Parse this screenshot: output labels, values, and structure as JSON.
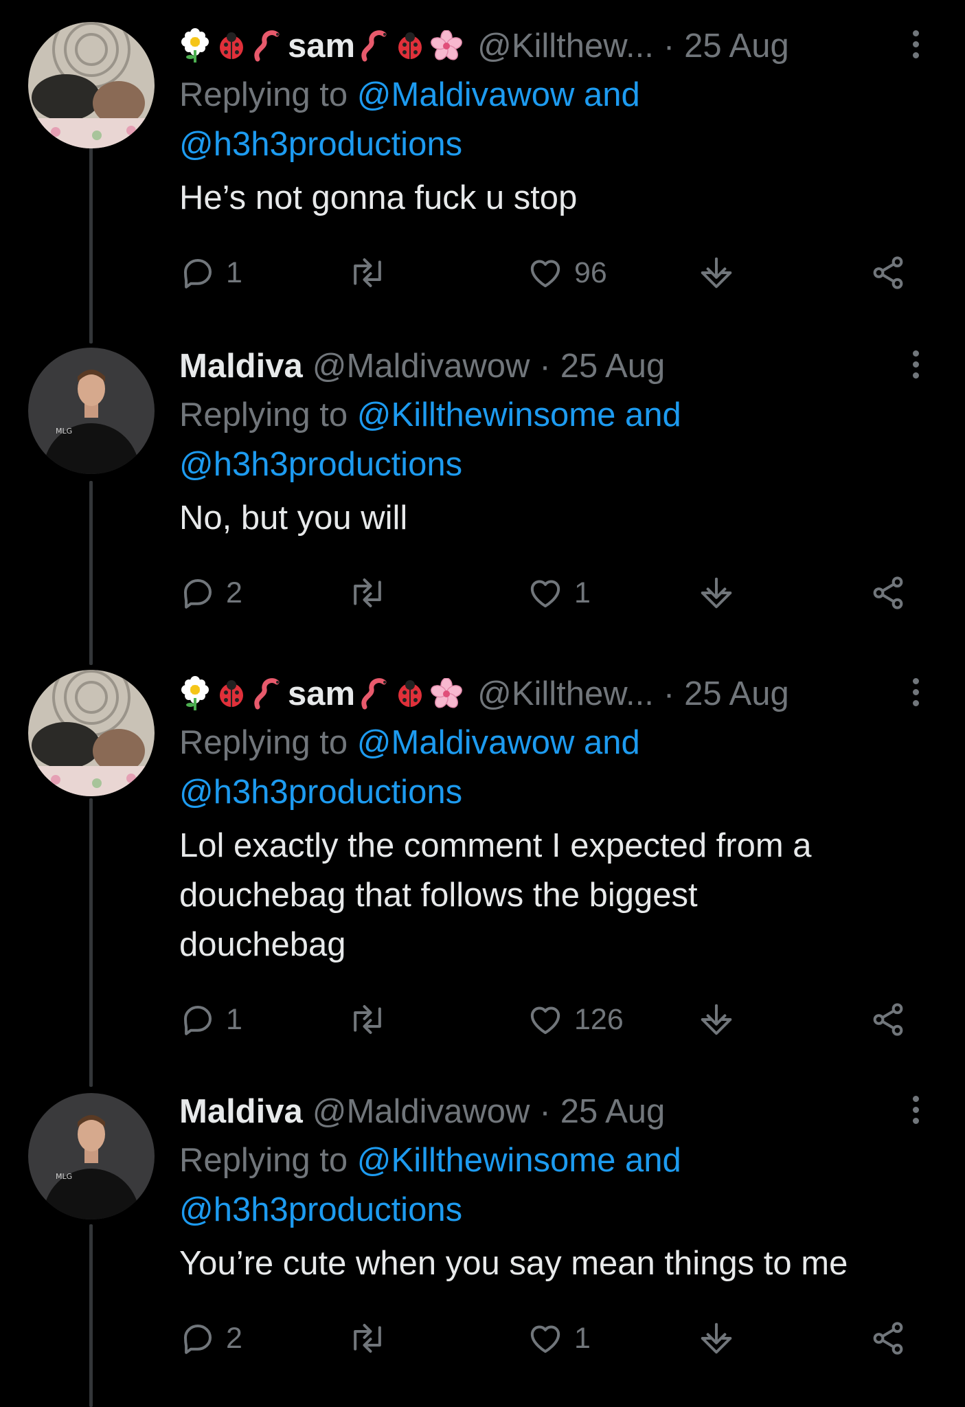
{
  "tweets": [
    {
      "display_name": "sam",
      "handle": "@Killthew...",
      "date": "25 Aug",
      "separator": "·",
      "replying_prefix": "Replying to",
      "replying_to_1": "@Maldivawow and",
      "replying_to_2": "@h3h3productions",
      "text_lines": [
        "He’s not gonna fuck u stop"
      ],
      "replies": "1",
      "retweets": "",
      "likes": "96",
      "avatar": "sam-avatar",
      "name_emoji": [
        "flower-emoji",
        "ladybug-emoji",
        "worm-emoji",
        "worm-emoji",
        "ladybug-emoji",
        "cherry-blossom-emoji"
      ]
    },
    {
      "display_name": "Maldiva",
      "handle": "@Maldivawow",
      "date": "25 Aug",
      "separator": "·",
      "replying_prefix": "Replying to",
      "replying_to_1": "@Killthewinsome and",
      "replying_to_2": "@h3h3productions",
      "text_lines": [
        "No, but you will"
      ],
      "replies": "2",
      "retweets": "",
      "likes": "1",
      "avatar": "maldiva-avatar",
      "name_emoji": []
    },
    {
      "display_name": "sam",
      "handle": "@Killthew...",
      "date": "25 Aug",
      "separator": "·",
      "replying_prefix": "Replying to",
      "replying_to_1": "@Maldivawow and",
      "replying_to_2": "@h3h3productions",
      "text_lines": [
        "Lol exactly the comment I expected from a",
        "douchebag that follows the biggest",
        "douchebag"
      ],
      "replies": "1",
      "retweets": "",
      "likes": "126",
      "avatar": "sam-avatar",
      "name_emoji": [
        "flower-emoji",
        "ladybug-emoji",
        "worm-emoji",
        "worm-emoji",
        "ladybug-emoji",
        "cherry-blossom-emoji"
      ]
    },
    {
      "display_name": "Maldiva",
      "handle": "@Maldivawow",
      "date": "25 Aug",
      "separator": "·",
      "replying_prefix": "Replying to",
      "replying_to_1": "@Killthewinsome and",
      "replying_to_2": "@h3h3productions",
      "text_lines": [
        "You’re cute when you say mean things to me"
      ],
      "replies": "2",
      "retweets": "",
      "likes": "1",
      "avatar": "maldiva-avatar",
      "name_emoji": []
    }
  ],
  "colors": {
    "background": "#000000",
    "text": "#e7e9ea",
    "secondary": "#71767b",
    "link": "#1d9bf0",
    "thread_line": "#333639"
  },
  "icons": [
    "reply-icon",
    "retweet-icon",
    "like-icon",
    "save-icon",
    "share-icon",
    "more-icon"
  ]
}
